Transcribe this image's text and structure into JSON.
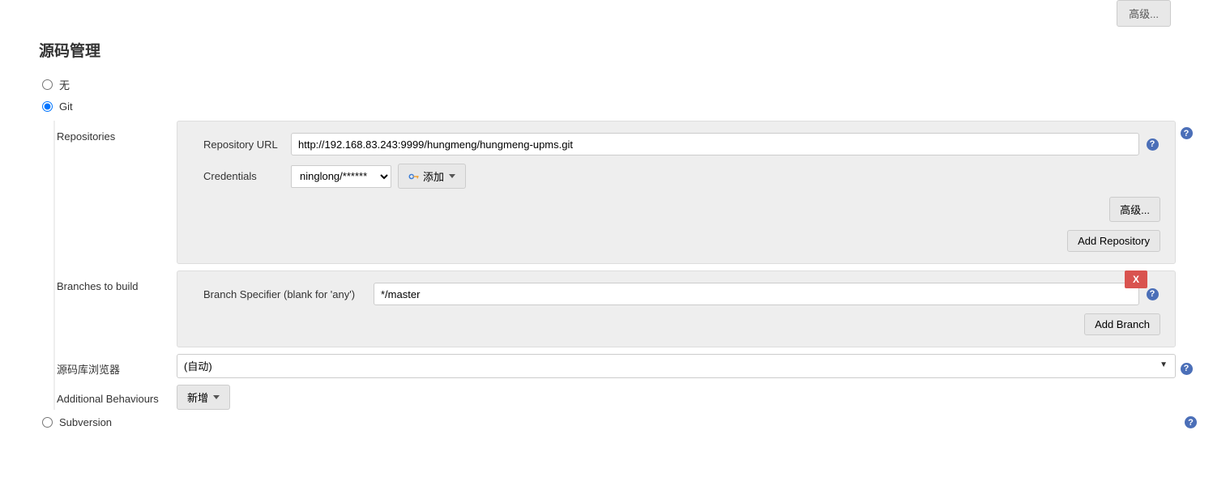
{
  "topButton": "高级...",
  "sectionTitle": "源码管理",
  "scm": {
    "noneLabel": "无",
    "gitLabel": "Git",
    "subversionLabel": "Subversion"
  },
  "repositories": {
    "label": "Repositories",
    "urlLabel": "Repository URL",
    "urlValue": "http://192.168.83.243:9999/hungmeng/hungmeng-upms.git",
    "credentialsLabel": "Credentials",
    "credentialsValue": "ninglong/******",
    "addCredLabel": "添加",
    "advancedLabel": "高级...",
    "addRepoLabel": "Add Repository"
  },
  "branches": {
    "label": "Branches to build",
    "specifierLabel": "Branch Specifier (blank for 'any')",
    "specifierValue": "*/master",
    "closeLabel": "X",
    "addBranchLabel": "Add Branch"
  },
  "browser": {
    "label": "源码库浏览器",
    "value": "(自动)"
  },
  "behaviours": {
    "label": "Additional Behaviours",
    "addLabel": "新增"
  }
}
